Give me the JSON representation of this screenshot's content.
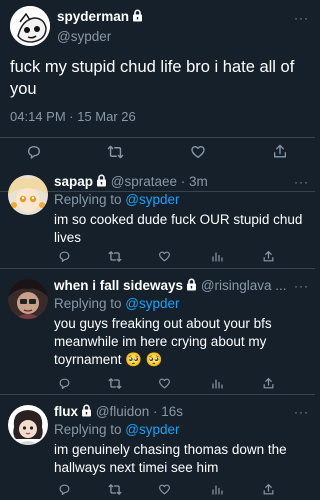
{
  "main_tweet": {
    "display_name": "spyderman",
    "handle": "@sypder",
    "text": "fuck my stupid chud life bro i hate all of you",
    "timestamp": "04:14 PM · 15 Mar 26",
    "more_label": "···"
  },
  "replies": [
    {
      "display_name": "sapap",
      "meta": " @sprataee · 3m",
      "replying_prefix": "Replying to ",
      "replying_handle": "@sypder",
      "text": "im so cooked dude fuck OUR stupid chud lives",
      "more_label": "···"
    },
    {
      "display_name": "when i fall sideways",
      "meta": " @risinglava ...",
      "replying_prefix": "Replying to ",
      "replying_handle": "@sypder",
      "text": "you guys freaking out about your bfs meanwhile im here crying about my toyrnament 🥺 🥺",
      "more_label": "···"
    },
    {
      "display_name": "flux",
      "meta": " @fluidon · 16s",
      "replying_prefix": "Replying to ",
      "replying_handle": "@sypder",
      "text": "im genuinely chasing thomas down the hallways next timei see him",
      "more_label": "···"
    }
  ],
  "icons": {
    "reply": "reply-icon",
    "retweet": "retweet-icon",
    "like": "heart-icon",
    "analytics": "analytics-icon",
    "share": "share-icon",
    "lock": "lock-icon"
  },
  "colors": {
    "background": "#15202b",
    "accent": "#1da1f2",
    "muted": "#8899a6",
    "divider": "#38444d"
  }
}
